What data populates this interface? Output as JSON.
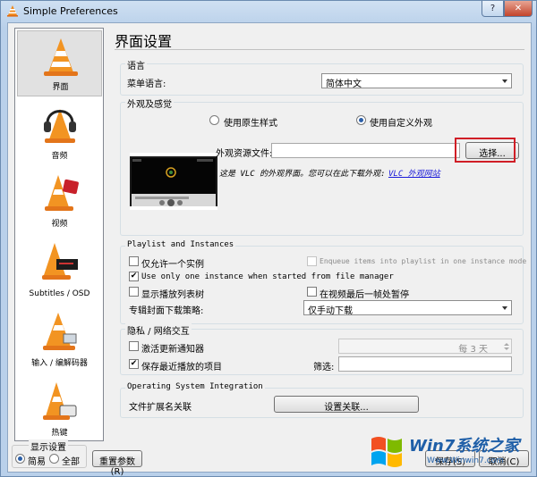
{
  "window": {
    "title": "Simple Preferences",
    "help": "?",
    "close": "✕"
  },
  "sidebar": {
    "items": [
      {
        "label": "界面",
        "icon": "vlc-cone-icon"
      },
      {
        "label": "音频",
        "icon": "headphones-cone-icon"
      },
      {
        "label": "视频",
        "icon": "film-cone-icon"
      },
      {
        "label": "Subtitles / OSD",
        "icon": "subtitles-cone-icon"
      },
      {
        "label": "输入 / 编解码器",
        "icon": "input-codecs-cone-icon"
      },
      {
        "label": "热键",
        "icon": "hotkeys-cone-icon"
      }
    ]
  },
  "page": {
    "title": "界面设置"
  },
  "language": {
    "group": "语言",
    "label": "菜单语言:",
    "value": "简体中文"
  },
  "look": {
    "group": "外观及感觉",
    "native_label": "使用原生样式",
    "custom_label": "使用自定义外观",
    "skin_label": "外观资源文件:",
    "skin_value": "",
    "choose": "选择...",
    "note": "这是 VLC 的外观界面。您可以在此下载外观:",
    "link": "VLC 外观网站"
  },
  "playlist": {
    "group": "Playlist and Instances",
    "one_instance": "仅允许一个实例",
    "enqueue": "Enqueue items into playlist in one instance mode",
    "fm_instance": "Use only one instance when started from file manager",
    "show_tree": "显示播放列表树",
    "pause_last": "在视频最后一帧处暂停",
    "art_label": "专辑封面下载策略:",
    "art_value": "仅手动下载"
  },
  "privacy": {
    "group": "隐私 / 网络交互",
    "updates": "激活更新通知器",
    "updates_interval": "每 3 天",
    "recent": "保存最近播放的项目",
    "filter_label": "筛选:",
    "filter_value": ""
  },
  "os": {
    "group": "Operating System Integration",
    "assoc_label": "文件扩展名关联",
    "assoc_button": "设置关联..."
  },
  "bottom": {
    "show_label": "显示设置",
    "simple": "简易",
    "all": "全部",
    "reset": "重置参数(R)",
    "save": "保存(S)",
    "cancel": "取消(C)"
  },
  "watermark": {
    "text": "Win7系统之家",
    "url": "Www.Winwin7.com"
  },
  "colors": {
    "accent": "#d01e26",
    "link": "#1a1ad8",
    "window_frame": "#b9d0ea"
  }
}
